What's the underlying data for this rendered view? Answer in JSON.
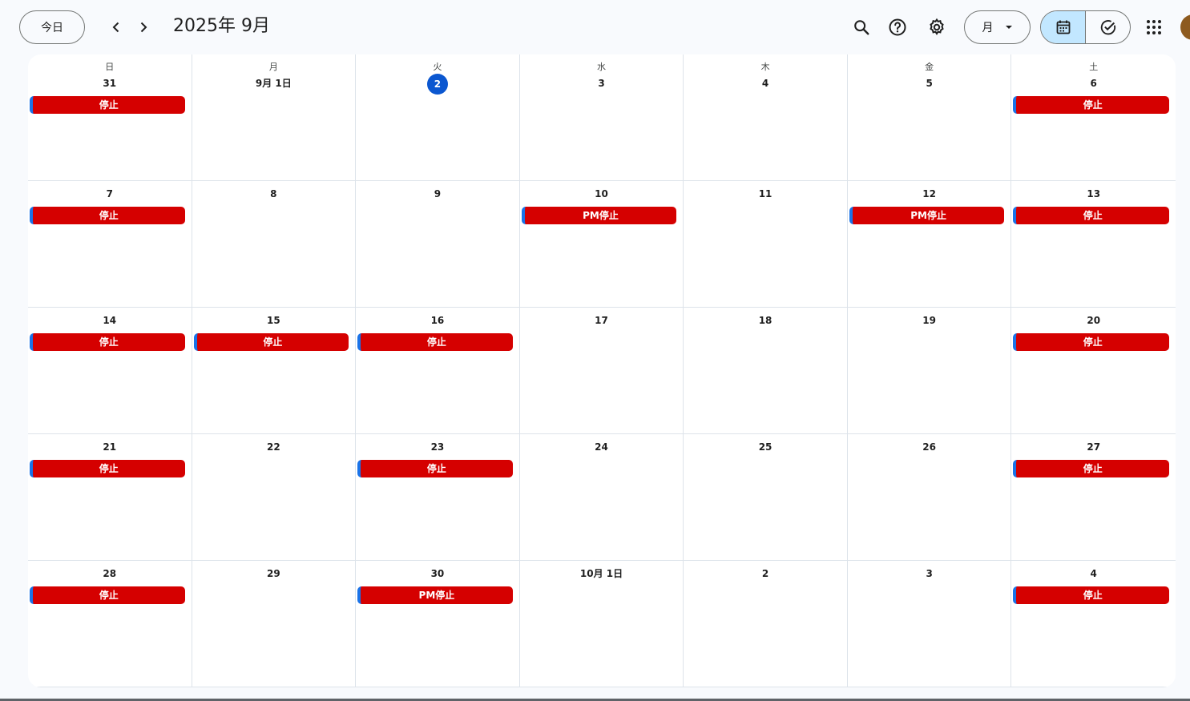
{
  "header": {
    "today_label": "今日",
    "period_title": "2025年 9月",
    "view_label": "月",
    "icons": {
      "prev": "chevron-left-icon",
      "next": "chevron-right-icon",
      "search": "search-icon",
      "help": "help-icon",
      "settings": "gear-icon",
      "dropdown": "caret-down-icon",
      "calendar_mode": "calendar-icon",
      "tasks_mode": "check-circle-icon",
      "apps": "apps-grid-icon"
    }
  },
  "calendar": {
    "weekdays": [
      "日",
      "月",
      "火",
      "水",
      "木",
      "金",
      "土"
    ],
    "today_index": 2,
    "event_color": "#d50000",
    "today_color": "#0b57d0",
    "days": [
      {
        "label": "31",
        "event": "停止"
      },
      {
        "label": "9月 1日",
        "event": ""
      },
      {
        "label": "2",
        "event": ""
      },
      {
        "label": "3",
        "event": ""
      },
      {
        "label": "4",
        "event": ""
      },
      {
        "label": "5",
        "event": ""
      },
      {
        "label": "6",
        "event": "停止"
      },
      {
        "label": "7",
        "event": "停止"
      },
      {
        "label": "8",
        "event": ""
      },
      {
        "label": "9",
        "event": ""
      },
      {
        "label": "10",
        "event": "PM停止"
      },
      {
        "label": "11",
        "event": ""
      },
      {
        "label": "12",
        "event": "PM停止"
      },
      {
        "label": "13",
        "event": "停止"
      },
      {
        "label": "14",
        "event": "停止"
      },
      {
        "label": "15",
        "event": "停止"
      },
      {
        "label": "16",
        "event": "停止"
      },
      {
        "label": "17",
        "event": ""
      },
      {
        "label": "18",
        "event": ""
      },
      {
        "label": "19",
        "event": ""
      },
      {
        "label": "20",
        "event": "停止"
      },
      {
        "label": "21",
        "event": "停止"
      },
      {
        "label": "22",
        "event": ""
      },
      {
        "label": "23",
        "event": "停止"
      },
      {
        "label": "24",
        "event": ""
      },
      {
        "label": "25",
        "event": ""
      },
      {
        "label": "26",
        "event": ""
      },
      {
        "label": "27",
        "event": "停止"
      },
      {
        "label": "28",
        "event": "停止"
      },
      {
        "label": "29",
        "event": ""
      },
      {
        "label": "30",
        "event": "PM停止"
      },
      {
        "label": "10月 1日",
        "event": ""
      },
      {
        "label": "2",
        "event": ""
      },
      {
        "label": "3",
        "event": ""
      },
      {
        "label": "4",
        "event": "停止"
      }
    ]
  }
}
